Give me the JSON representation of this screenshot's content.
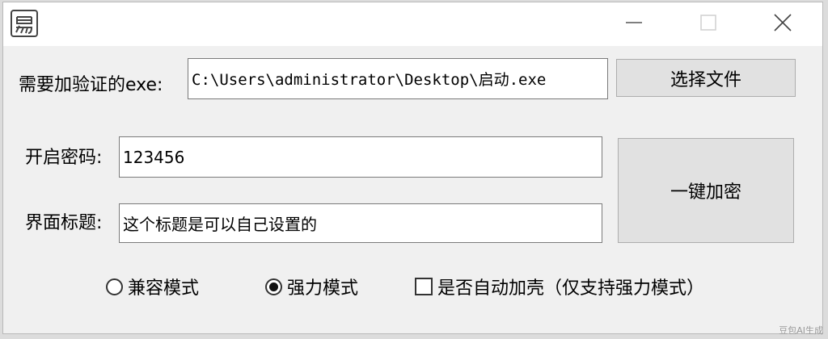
{
  "window": {
    "icon": "app-logo-icon",
    "controls": {
      "minimize": "minimize-icon",
      "maximize": "maximize-icon",
      "close": "close-icon"
    }
  },
  "form": {
    "exe_label": "需要加验证的exe:",
    "exe_path": "C:\\Users\\administrator\\Desktop\\启动.exe",
    "choose_file_button": "选择文件",
    "password_label": "开启密码:",
    "password_value": "123456",
    "title_label": "界面标题:",
    "title_value": "这个标题是可以自己设置的",
    "encrypt_button": "一键加密"
  },
  "options": {
    "compat_mode": {
      "label": "兼容模式",
      "checked": false
    },
    "strong_mode": {
      "label": "强力模式",
      "checked": true
    },
    "auto_shell": {
      "label": "是否自动加壳（仅支持强力模式）",
      "checked": false
    }
  },
  "watermark": "豆包AI生成"
}
